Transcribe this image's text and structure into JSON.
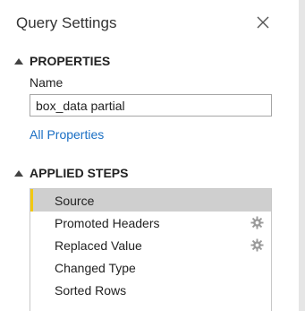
{
  "panel": {
    "title": "Query Settings",
    "close_icon": "close-icon"
  },
  "properties": {
    "header": "PROPERTIES",
    "name_label": "Name",
    "name_value": "box_data partial",
    "all_properties_link": "All Properties"
  },
  "applied_steps": {
    "header": "APPLIED STEPS",
    "steps": [
      {
        "label": "Source",
        "selected": true,
        "has_settings": false
      },
      {
        "label": "Promoted Headers",
        "selected": false,
        "has_settings": true
      },
      {
        "label": "Replaced Value",
        "selected": false,
        "has_settings": true
      },
      {
        "label": "Changed Type",
        "selected": false,
        "has_settings": false
      },
      {
        "label": "Sorted Rows",
        "selected": false,
        "has_settings": false
      }
    ]
  },
  "colors": {
    "link": "#1a6fc4",
    "selected_row": "#cfcfcf",
    "selected_marker": "#f2c811"
  }
}
